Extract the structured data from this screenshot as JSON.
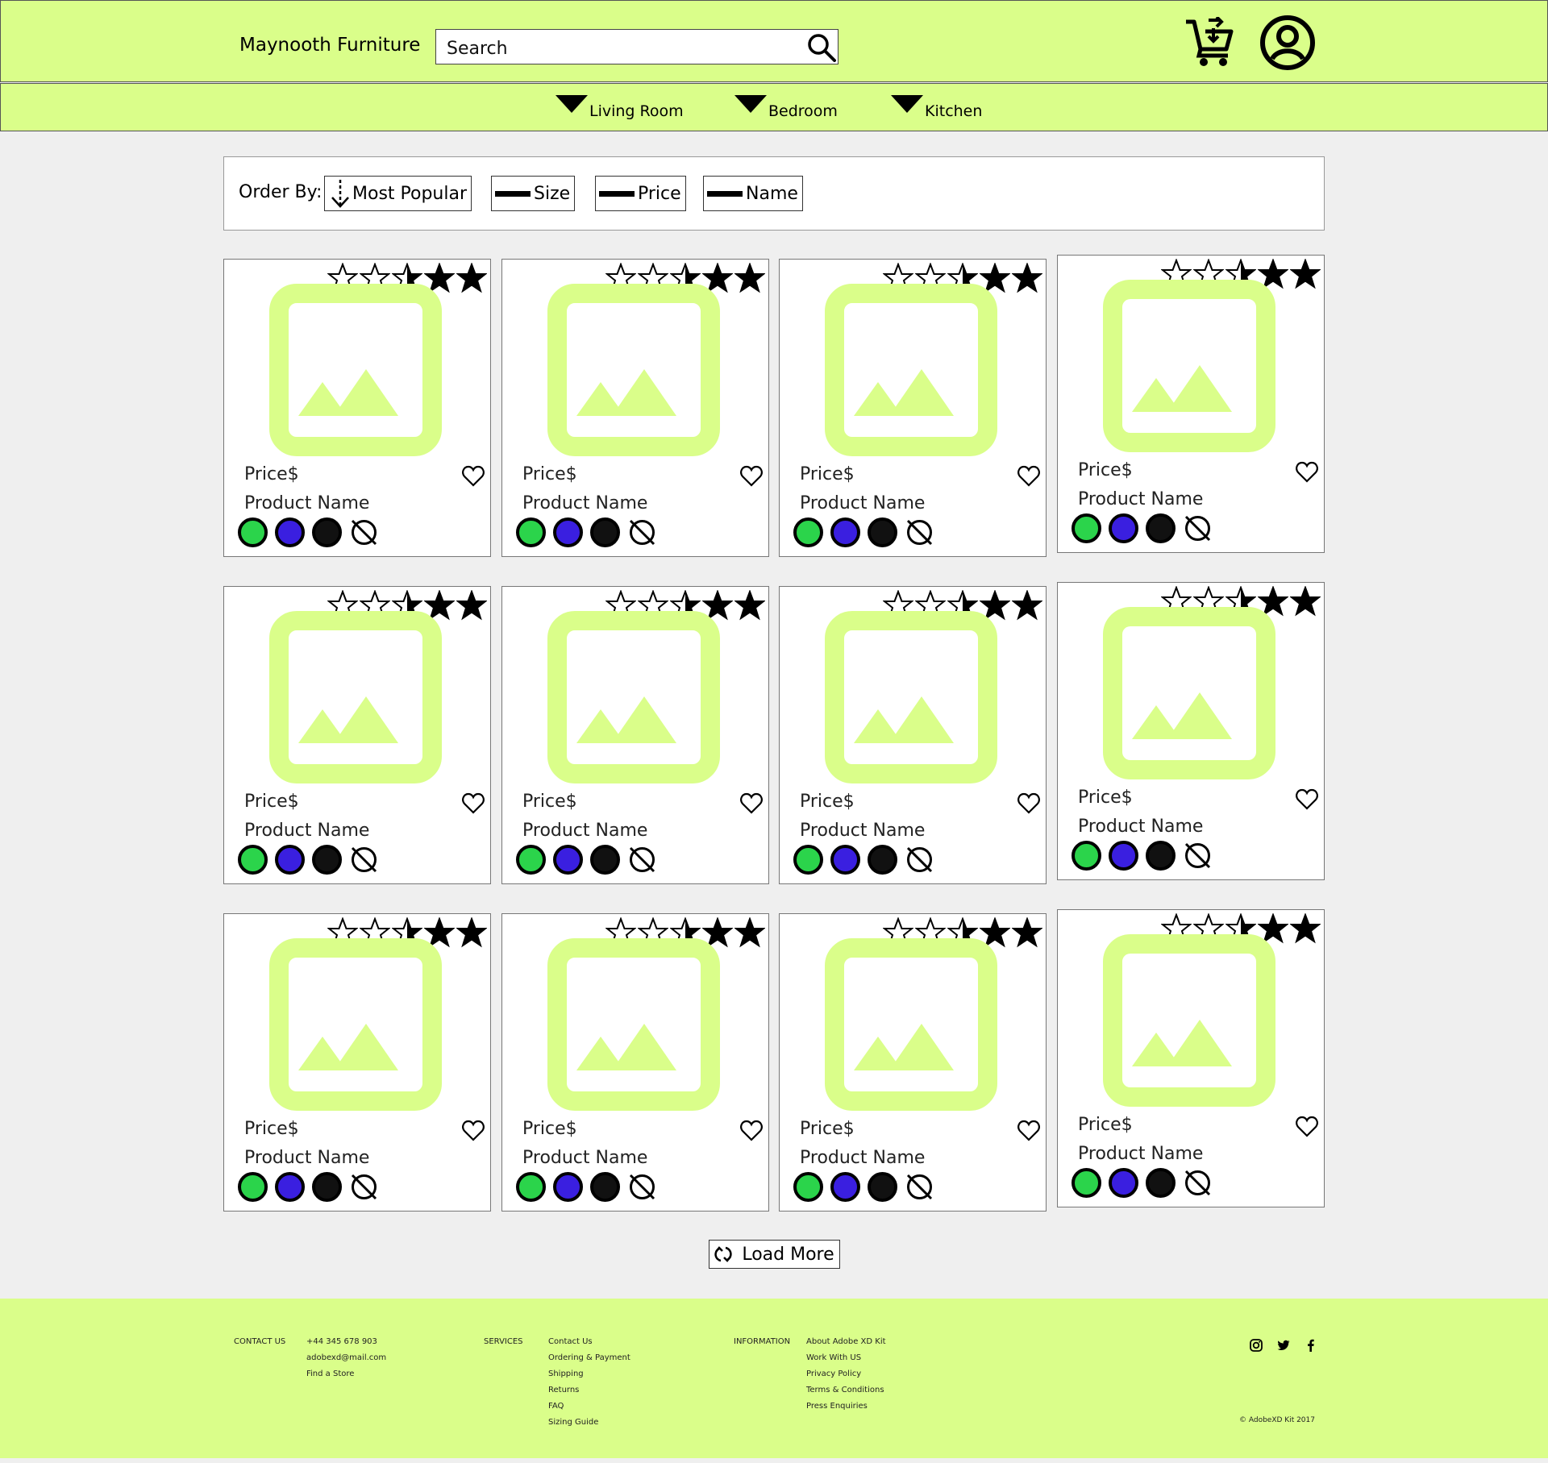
{
  "header": {
    "brand": "Maynooth Furniture",
    "search_placeholder": "Search"
  },
  "categories": [
    {
      "label": "Living Room"
    },
    {
      "label": "Bedroom"
    },
    {
      "label": "Kitchen"
    }
  ],
  "order_bar": {
    "label": "Order By:",
    "options": [
      {
        "label": "Most Popular",
        "icon": "sort-down-arrow-icon"
      },
      {
        "label": "Size",
        "icon": "dash-icon"
      },
      {
        "label": "Price",
        "icon": "dash-icon"
      },
      {
        "label": "Name",
        "icon": "dash-icon"
      }
    ]
  },
  "products": {
    "rating": 2.5,
    "rating_max": 5,
    "items": [
      {
        "price": "Price$",
        "name": "Product Name"
      },
      {
        "price": "Price$",
        "name": "Product Name"
      },
      {
        "price": "Price$",
        "name": "Product Name"
      },
      {
        "price": "Price$",
        "name": "Product Name"
      },
      {
        "price": "Price$",
        "name": "Product Name"
      },
      {
        "price": "Price$",
        "name": "Product Name"
      },
      {
        "price": "Price$",
        "name": "Product Name"
      },
      {
        "price": "Price$",
        "name": "Product Name"
      },
      {
        "price": "Price$",
        "name": "Product Name"
      },
      {
        "price": "Price$",
        "name": "Product Name"
      },
      {
        "price": "Price$",
        "name": "Product Name"
      },
      {
        "price": "Price$",
        "name": "Product Name"
      }
    ],
    "swatch_colors": [
      "#2bd44b",
      "#3a1fe0",
      "#111111"
    ]
  },
  "load_more": "Load More",
  "footer": {
    "contact": {
      "heading": "CONTACT US",
      "items": [
        "+44 345 678 903",
        "adobexd@mail.com",
        "Find a Store"
      ]
    },
    "services": {
      "heading": "SERVICES",
      "items": [
        "Contact Us",
        "Ordering & Payment",
        "Shipping",
        "Returns",
        "FAQ",
        "Sizing Guide"
      ]
    },
    "information": {
      "heading": "INFORMATION",
      "items": [
        "About Adobe XD Kit",
        "Work With US",
        "Privacy Policy",
        "Terms & Conditions",
        "Press Enquiries"
      ]
    },
    "social": [
      "instagram-icon",
      "twitter-icon",
      "facebook-icon"
    ],
    "copyright": "© AdobeXD Kit 2017"
  },
  "colors": {
    "accent": "#dafe8a",
    "background": "#efefef"
  }
}
